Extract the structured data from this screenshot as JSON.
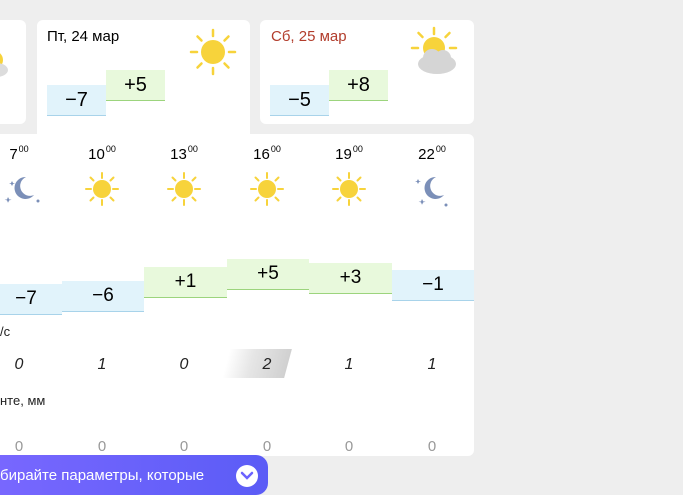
{
  "days": [
    {
      "date": "Пт, 24 мар",
      "min": "−7",
      "max": "+5",
      "icon": "sun-icon",
      "weekend": false
    },
    {
      "date": "Сб, 25 мар",
      "min": "−5",
      "max": "+8",
      "icon": "partly-cloudy-icon",
      "weekend": true
    }
  ],
  "hours": [
    {
      "h": "7",
      "m": "00",
      "icon": "night-icon",
      "temp": "−7",
      "wind": "0",
      "precip": "0"
    },
    {
      "h": "10",
      "m": "00",
      "icon": "sun-icon",
      "temp": "−6",
      "wind": "1",
      "precip": "0"
    },
    {
      "h": "13",
      "m": "00",
      "icon": "sun-icon",
      "temp": "+1",
      "wind": "0",
      "precip": "0"
    },
    {
      "h": "16",
      "m": "00",
      "icon": "sun-icon",
      "temp": "+5",
      "wind": "2",
      "precip": "0"
    },
    {
      "h": "19",
      "m": "00",
      "icon": "sun-icon",
      "temp": "+3",
      "wind": "1",
      "precip": "0"
    },
    {
      "h": "22",
      "m": "00",
      "icon": "night-icon",
      "temp": "−1",
      "wind": "1",
      "precip": "0"
    }
  ],
  "labels": {
    "wind_unit": "/с",
    "precip_unit": "нте, мм"
  },
  "banner": {
    "text": "бирайте параметры, которые"
  },
  "colors": {
    "weekend": "#b23d2c",
    "sun": "#f7d33b",
    "moon": "#7b8fb8",
    "banner": "#6c63ff"
  }
}
